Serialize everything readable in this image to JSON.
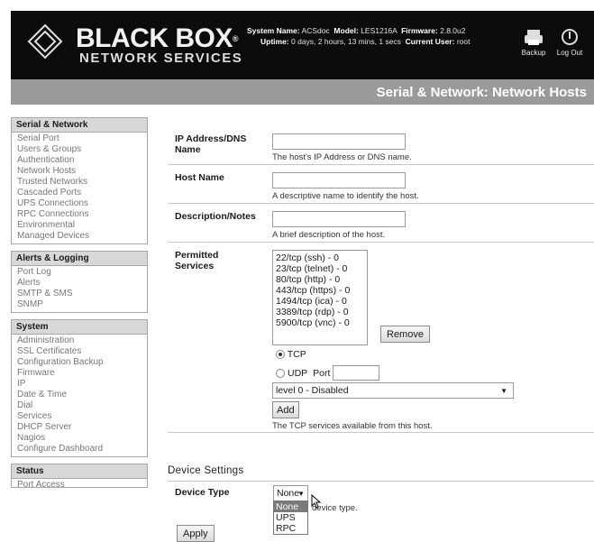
{
  "header": {
    "logo_main": "BLACK BOX",
    "logo_trademark": "®",
    "logo_sub": "NETWORK SERVICES",
    "system_name_label": "System Name:",
    "system_name": "ACSdoc",
    "model_label": "Model:",
    "model": "LES1216A",
    "firmware_label": "Firmware:",
    "firmware": "2.8.0u2",
    "uptime_label": "Uptime:",
    "uptime": "0 days, 2 hours, 13 mins, 1 secs",
    "current_user_label": "Current User:",
    "current_user": "root",
    "backup_label": "Backup",
    "backup_icon": "printer-icon",
    "logout_label": "Log Out",
    "logout_icon": "power-icon"
  },
  "page_title": "Serial & Network: Network Hosts",
  "sidebar": {
    "groups": [
      {
        "title": "Serial & Network",
        "items": [
          "Serial Port",
          "Users & Groups",
          "Authentication",
          "Network Hosts",
          "Trusted Networks",
          "Cascaded Ports",
          "UPS Connections",
          "RPC Connections",
          "Environmental",
          "Managed Devices"
        ]
      },
      {
        "title": "Alerts & Logging",
        "items": [
          "Port Log",
          "Alerts",
          "SMTP & SMS",
          "SNMP"
        ]
      },
      {
        "title": "System",
        "items": [
          "Administration",
          "SSL Certificates",
          "Configuration Backup",
          "Firmware",
          "IP",
          "Date & Time",
          "Dial",
          "Services",
          "DHCP Server",
          "Nagios",
          "Configure Dashboard"
        ]
      },
      {
        "title": "Status",
        "items": [
          "Port Access"
        ]
      }
    ]
  },
  "form": {
    "ip_label": "IP Address/DNS Name",
    "ip_value": "",
    "ip_help": "The host's IP Address or DNS name.",
    "hostname_label": "Host Name",
    "hostname_value": "",
    "hostname_help": "A descriptive name to identify the host.",
    "desc_label": "Description/Notes",
    "desc_value": "",
    "desc_help": "A brief description of the host.",
    "services_label": "Permitted Services",
    "services": [
      "22/tcp (ssh) - 0",
      "23/tcp (telnet) - 0",
      "80/tcp (http) - 0",
      "443/tcp (https) - 0",
      "1494/tcp (ica) - 0",
      "3389/tcp (rdp) - 0",
      "5900/tcp (vnc) - 0"
    ],
    "remove_label": "Remove",
    "tcp_label": "TCP",
    "udp_label": "UDP",
    "port_label": "Port",
    "port_value": "",
    "level_value": "level 0 - Disabled",
    "add_label": "Add",
    "services_help": "The TCP services available from this host."
  },
  "device_settings": {
    "section_title": "Device Settings",
    "device_type_label": "Device Type",
    "device_type_value": "None",
    "device_type_help": "device type.",
    "device_type_options": [
      "None",
      "UPS",
      "RPC"
    ]
  },
  "apply_label": "Apply"
}
